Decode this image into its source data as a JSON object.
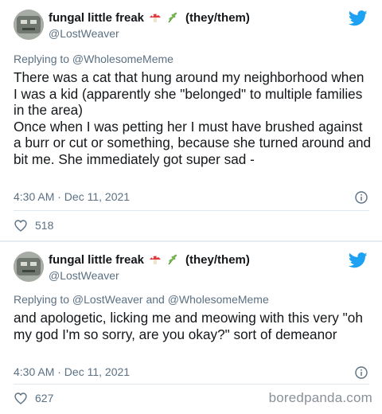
{
  "tweets": [
    {
      "author": {
        "name": "fungal little freak",
        "pronouns": "(they/them)",
        "handle": "@LostWeaver"
      },
      "replying_to": "Replying to @WholesomeMeme",
      "text": "There was a cat that hung around my neighborhood when I was a kid (apparently she \"belonged\" to multiple families in the area)\nOnce when I was petting her I must have brushed against a burr or cut or something, because she turned around and bit me. She immediately got super sad -",
      "timestamp": "4:30 AM · Dec 11, 2021",
      "likes": "518"
    },
    {
      "author": {
        "name": "fungal little freak",
        "pronouns": "(they/them)",
        "handle": "@LostWeaver"
      },
      "replying_to": "Replying to @LostWeaver and @WholesomeMeme",
      "text": "and apologetic, licking me and meowing with this very \"oh my god I'm so sorry, are you okay?\" sort of demeanor",
      "timestamp": "4:30 AM · Dec 11, 2021",
      "likes": "627"
    }
  ],
  "watermark": "boredpanda.com",
  "icons": {
    "twitter": "twitter-bird-icon",
    "info": "info-icon",
    "like": "heart-icon",
    "emoji": [
      "mushroom-emoji",
      "herb-emoji"
    ]
  },
  "colors": {
    "twitter_blue": "#1da1f2",
    "secondary_text": "#5b7083",
    "text": "#14171a",
    "divider": "#e1e8ed"
  }
}
